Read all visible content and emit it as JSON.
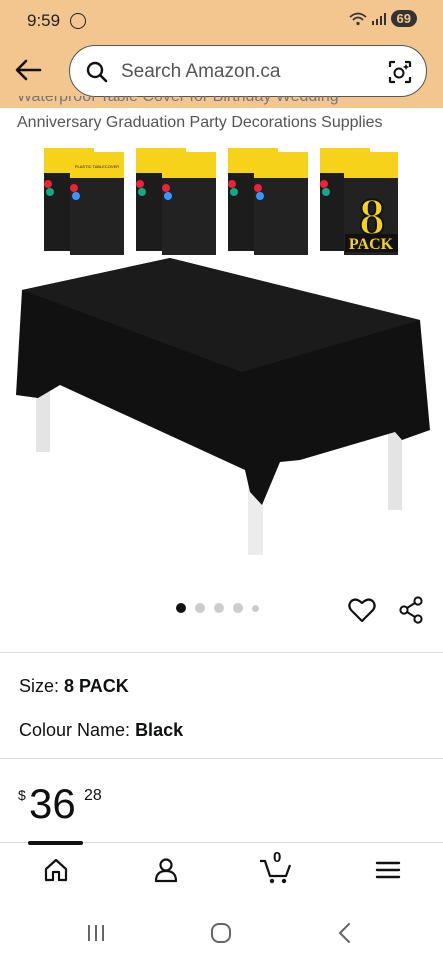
{
  "status_bar": {
    "time": "9:59",
    "battery": "69"
  },
  "search": {
    "placeholder": "Search Amazon.ca"
  },
  "product": {
    "title_partial": "Waterproof Table Cover for Birthday Wedding",
    "title": "Anniversary Graduation Party Decorations Supplies",
    "pack_badge_number": "8",
    "pack_badge_text": "PACK",
    "package_label": "PLASTIC TABLECOVER"
  },
  "carousel": {
    "total": 5,
    "active_index": 0
  },
  "size": {
    "label": "Size:",
    "value": "8 PACK"
  },
  "colour": {
    "label": "Colour Name:",
    "value": "Black"
  },
  "price": {
    "currency": "$",
    "whole": "36",
    "fraction": "28"
  },
  "bottom_nav": {
    "cart_count": "0"
  },
  "colors": {
    "header_bg": "#f3c68f",
    "badge_yellow": "#f7d21a"
  }
}
